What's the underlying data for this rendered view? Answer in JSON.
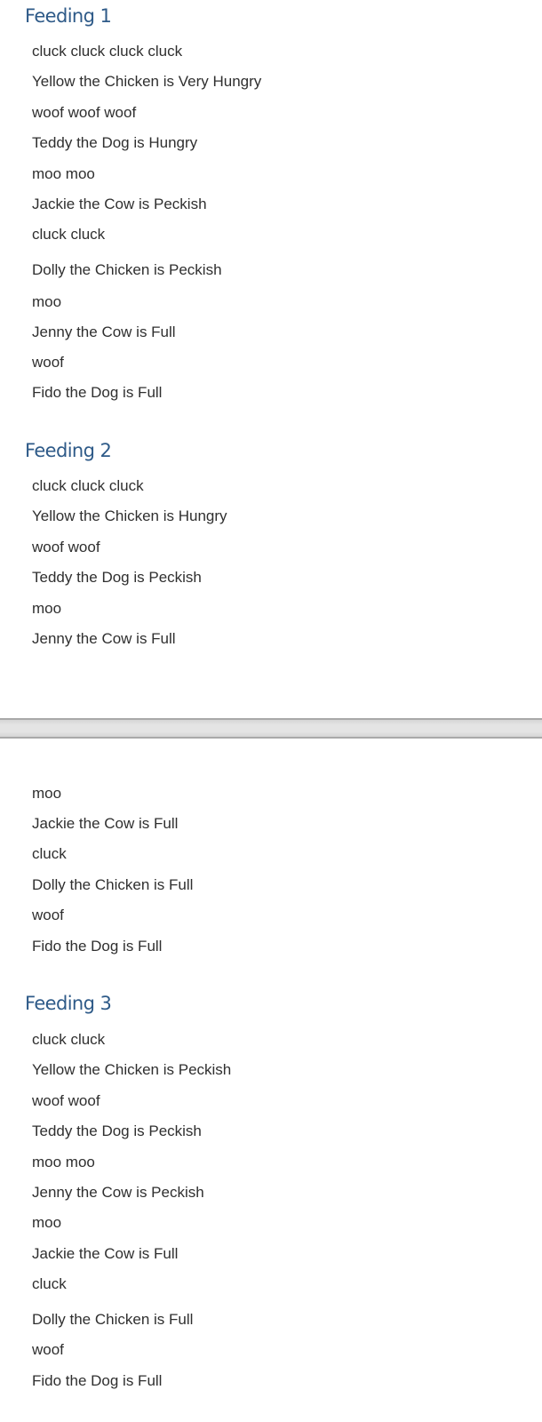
{
  "document": {
    "sections": [
      {
        "heading": "Feeding 1",
        "lines": [
          "cluck cluck cluck cluck",
          "Yellow the Chicken is Very Hungry",
          "woof woof woof",
          "Teddy the Dog is Hungry",
          "moo moo",
          "Jackie the Cow is Peckish",
          "cluck cluck",
          "Dolly the Chicken is Peckish",
          "moo",
          "Jenny the Cow is Full",
          "woof",
          "Fido the Dog is Full"
        ]
      },
      {
        "heading": "Feeding 2",
        "lines": [
          "cluck cluck cluck",
          "Yellow the Chicken is Hungry",
          "woof woof",
          "Teddy the Dog is Peckish",
          "moo",
          "Jenny the Cow is Full",
          "moo",
          "Jackie the Cow is Full",
          "cluck",
          "Dolly the Chicken is Full",
          "woof",
          "Fido the Dog is Full"
        ]
      },
      {
        "heading": "Feeding 3",
        "lines": [
          "cluck cluck",
          "Yellow the Chicken is Peckish",
          "woof woof",
          "Teddy the Dog is Peckish",
          "moo moo",
          "Jenny the Cow is Peckish",
          "moo",
          "Jackie the Cow is Full",
          "cluck",
          "Dolly the Chicken is Full",
          "woof",
          "Fido the Dog is Full"
        ]
      }
    ],
    "colors": {
      "heading": "#2e5a88",
      "body_text": "#2f2f2f",
      "page_break": "#e4e4e4"
    }
  }
}
